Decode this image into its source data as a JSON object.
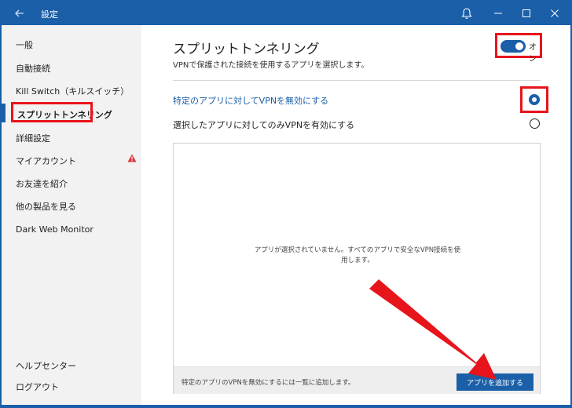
{
  "window": {
    "title": "設定"
  },
  "titlebar_icons": [
    "back-arrow-icon",
    "bell-icon",
    "minimize-icon",
    "maximize-icon",
    "close-icon"
  ],
  "sidebar": {
    "items": [
      {
        "label": "一般"
      },
      {
        "label": "自動接続"
      },
      {
        "label": "Kill Switch（キルスイッチ）"
      },
      {
        "label": "スプリットトンネリング",
        "active": true
      },
      {
        "label": "詳細設定"
      },
      {
        "label": "マイアカウント",
        "warning": true
      },
      {
        "label": "お友達を紹介"
      },
      {
        "label": "他の製品を見る"
      },
      {
        "label": "Dark Web Monitor"
      }
    ],
    "bottom": [
      {
        "label": "ヘルプセンター"
      },
      {
        "label": "ログアウト"
      }
    ]
  },
  "main": {
    "title": "スプリットトンネリング",
    "subtitle": "VPNで保護された接続を使用するアプリを選択します。",
    "toggle": {
      "label": "オン",
      "on": true
    },
    "options": [
      {
        "label": "特定のアプリに対してVPNを無効にする",
        "selected": true
      },
      {
        "label": "選択したアプリに対してのみVPNを有効にする",
        "selected": false
      }
    ],
    "empty_message": "アプリが選択されていません。すべてのアプリで安全なVPN接続を使用します。",
    "footer_hint": "特定のアプリのVPNを無効にするには一覧に追加します。",
    "add_button": "アプリを追加する"
  },
  "colors": {
    "accent": "#1a5fa8",
    "annotation": "#e8141c",
    "sidebar_bg": "#f2f2f2"
  }
}
